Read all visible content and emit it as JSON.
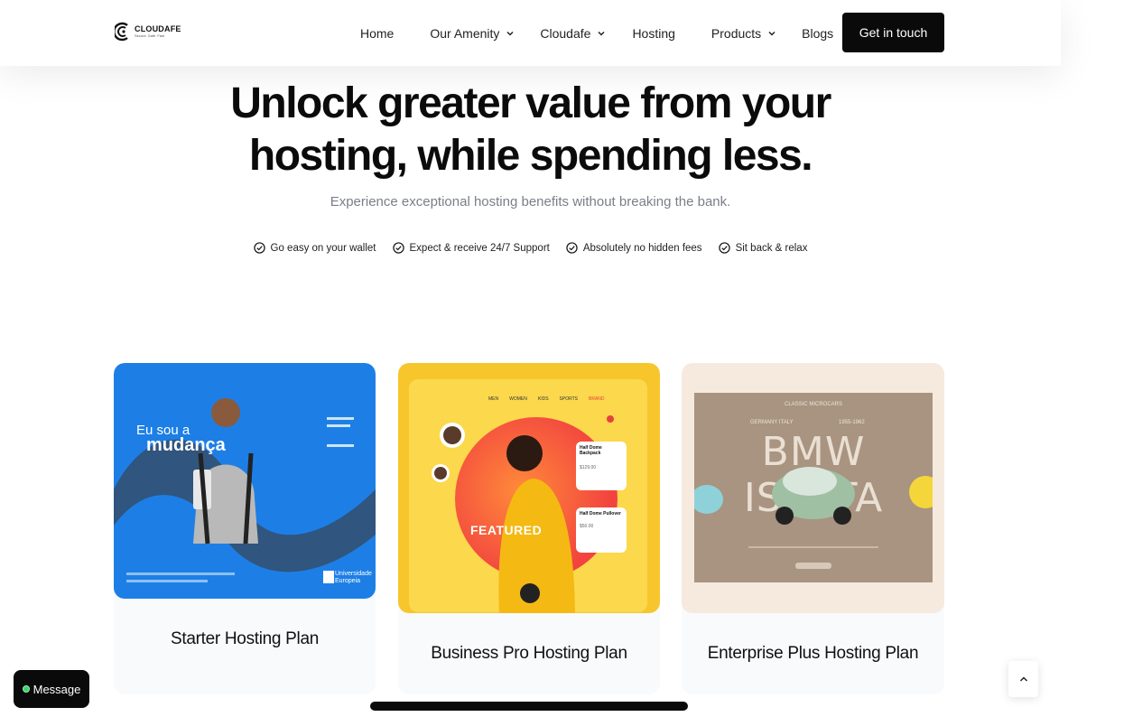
{
  "header": {
    "logo_name": "CLOUDAFE",
    "logo_tagline": "Secure. Safe. Fast",
    "nav": [
      {
        "label": "Home",
        "has_dropdown": false
      },
      {
        "label": "Our Amenity",
        "has_dropdown": true
      },
      {
        "label": "Cloudafe",
        "has_dropdown": true
      },
      {
        "label": "Hosting",
        "has_dropdown": false
      },
      {
        "label": "Products",
        "has_dropdown": true
      },
      {
        "label": "Blogs",
        "has_dropdown": false
      }
    ],
    "cta_label": "Get in touch"
  },
  "hero": {
    "title_line1": "Unlock greater value from your",
    "title_line2": "hosting, while spending less.",
    "subtitle": "Experience exceptional hosting benefits without breaking the bank.",
    "features": [
      "Go easy on your wallet",
      "Expect & receive 24/7 Support",
      "Absolutely no hidden fees",
      "Sit back & relax"
    ]
  },
  "plans": [
    {
      "title": "Starter Hosting Plan",
      "thumb": {
        "text1": "Eu sou a",
        "text2": "mudança",
        "brand": "Universidade Europeia",
        "bg": "#1d7fe6"
      }
    },
    {
      "title": "Business Pro Hosting Plan",
      "thumb": {
        "badge": "FEATURED",
        "nav": [
          "MEN",
          "WOMEN",
          "KIDS",
          "SPORTS",
          "BRAND"
        ],
        "item1": "Half Dome Backpack",
        "price1": "$129.00",
        "item2": "Half Dome Pullover",
        "price2": "$50.00",
        "bg": "#f7c62c"
      }
    },
    {
      "title": "Enterprise Plus Hosting Plan",
      "thumb": {
        "eyebrow": "CLASSIC MICROCARS",
        "heading": "BMW ISETTA",
        "left_sub": "GERMANY ITALY",
        "right_sub": "1955-1962",
        "bg": "#f6eadf"
      }
    }
  ],
  "chat": {
    "label": "Message"
  },
  "colors": {
    "accent": "#0a0a0a",
    "online": "#3bd16f",
    "muted_text": "#7a7f87"
  }
}
